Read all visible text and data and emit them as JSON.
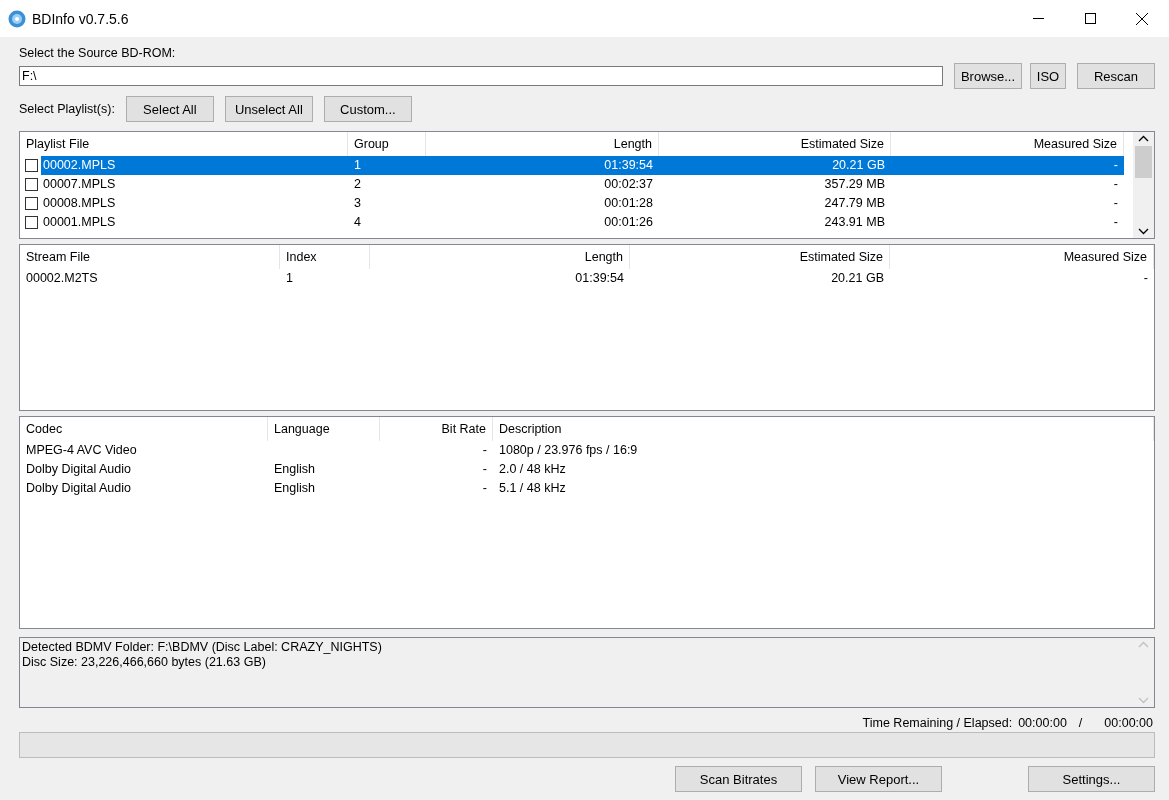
{
  "window": {
    "title": "BDInfo v0.7.5.6"
  },
  "source": {
    "label": "Select the Source BD-ROM:",
    "value": "F:\\",
    "buttons": [
      "Browse...",
      "ISO",
      "Rescan"
    ]
  },
  "playlist_select": {
    "label": "Select Playlist(s):",
    "buttons": [
      "Select All",
      "Unselect All",
      "Custom..."
    ]
  },
  "playlists": {
    "columns": [
      "Playlist File",
      "Group",
      "Length",
      "Estimated Size",
      "Measured Size"
    ],
    "rows": [
      {
        "file": "00002.MPLS",
        "group": "1",
        "length": "01:39:54",
        "estimated": "20.21 GB",
        "measured": "-",
        "checked": false,
        "selected": true
      },
      {
        "file": "00007.MPLS",
        "group": "2",
        "length": "00:02:37",
        "estimated": "357.29 MB",
        "measured": "-",
        "checked": false,
        "selected": false
      },
      {
        "file": "00008.MPLS",
        "group": "3",
        "length": "00:01:28",
        "estimated": "247.79 MB",
        "measured": "-",
        "checked": false,
        "selected": false
      },
      {
        "file": "00001.MPLS",
        "group": "4",
        "length": "00:01:26",
        "estimated": "243.91 MB",
        "measured": "-",
        "checked": false,
        "selected": false
      }
    ]
  },
  "streams": {
    "columns": [
      "Stream File",
      "Index",
      "Length",
      "Estimated Size",
      "Measured Size"
    ],
    "rows": [
      [
        "00002.M2TS",
        "1",
        "01:39:54",
        "20.21 GB",
        "-"
      ]
    ]
  },
  "codecs": {
    "columns": [
      "Codec",
      "Language",
      "Bit Rate",
      "Description"
    ],
    "rows": [
      [
        "MPEG-4 AVC Video",
        "",
        "-",
        "1080p / 23.976 fps / 16:9"
      ],
      [
        "Dolby Digital Audio",
        "English",
        "-",
        "2.0 / 48 kHz"
      ],
      [
        "Dolby Digital Audio",
        "English",
        "-",
        "5.1 / 48 kHz"
      ]
    ]
  },
  "log": [
    "Detected BDMV Folder: F:\\BDMV (Disc Label: CRAZY_NIGHTS)",
    "Disc Size: 23,226,466,660 bytes (21.63 GB)"
  ],
  "time": {
    "label": "Time Remaining / Elapsed:",
    "remaining": "00:00:00",
    "separator": "/",
    "elapsed": "00:00:00"
  },
  "progress": {
    "level": 0
  },
  "footer_buttons": [
    "Scan Bitrates",
    "View Report...",
    "Settings..."
  ]
}
